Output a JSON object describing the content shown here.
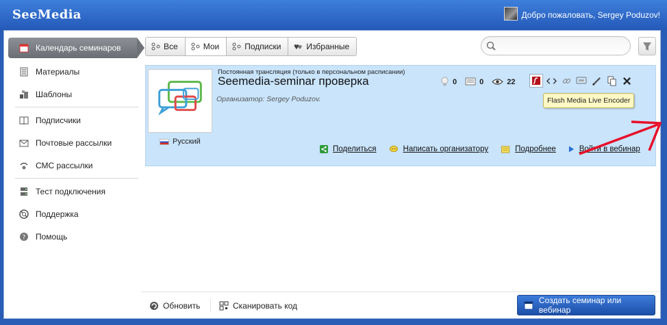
{
  "header": {
    "brand": "SeeMedia",
    "welcome": "Добро пожаловать, Sergey Poduzov!"
  },
  "sidebar": {
    "items": [
      {
        "label": "Календарь семинаров",
        "icon": "calendar-icon",
        "active": true
      },
      {
        "label": "Материалы",
        "icon": "materials-icon"
      },
      {
        "label": "Шаблоны",
        "icon": "templates-icon"
      },
      {
        "label": "Подписчики",
        "icon": "book-icon"
      },
      {
        "label": "Почтовые рассылки",
        "icon": "mail-icon"
      },
      {
        "label": "СМС рассылки",
        "icon": "sms-icon"
      },
      {
        "label": "Тест подключения",
        "icon": "server-icon"
      },
      {
        "label": "Поддержка",
        "icon": "lifebuoy-icon"
      },
      {
        "label": "Помощь",
        "icon": "help-icon"
      }
    ]
  },
  "tabs": [
    {
      "label": "Все"
    },
    {
      "label": "Мои",
      "active": true
    },
    {
      "label": "Подписки"
    },
    {
      "label": "Избранные"
    }
  ],
  "search": {
    "placeholder": ""
  },
  "card": {
    "subtitle": "Постоянная трансляция (только в персональном расписании)",
    "title": "Seemedia-seminar проверка",
    "organizer": "Организатор: Sergey Poduzov.",
    "language": "Русский",
    "stats": {
      "likes": "0",
      "comments": "0",
      "views": "22"
    },
    "tooltip": "Flash Media Live Encoder",
    "actions": {
      "share": "Поделиться",
      "write": "Написать организатору",
      "details": "Подробнее",
      "enter": "Войти в вебинар"
    }
  },
  "footer": {
    "refresh": "Обновить",
    "scan": "Сканировать код",
    "create": "Создать семинар или вебинар"
  },
  "colors": {
    "header": "#2f6bcb",
    "card_bg": "#c9e4fb",
    "arrow": "#e8102a"
  }
}
